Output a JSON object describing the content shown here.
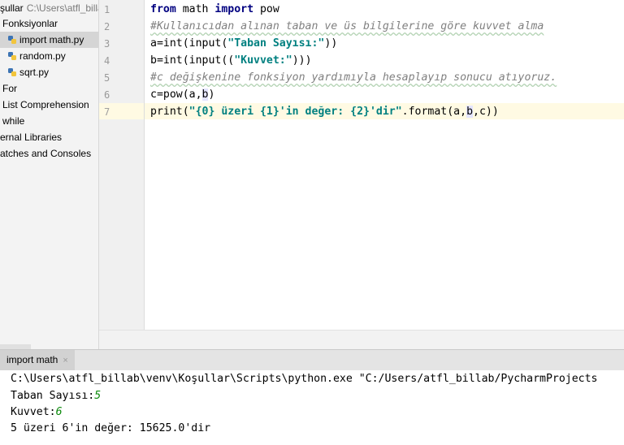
{
  "tree": {
    "root_label": "şullar",
    "root_path": "C:\\Users\\atfl_billab\\venv",
    "items": [
      {
        "label": "Fonksiyonlar",
        "icon": "folder-icon"
      },
      {
        "label": "import math.py",
        "icon": "python-file-icon"
      },
      {
        "label": "random.py",
        "icon": "python-file-icon"
      },
      {
        "label": "sqrt.py",
        "icon": "python-file-icon"
      },
      {
        "label": "For",
        "icon": "folder-icon"
      },
      {
        "label": "List Comprehension",
        "icon": "folder-icon"
      },
      {
        "label": "while",
        "icon": "folder-icon"
      },
      {
        "label": "ernal Libraries",
        "icon": "library-icon"
      },
      {
        "label": "atches and Consoles",
        "icon": "scratch-icon"
      }
    ]
  },
  "editor": {
    "line_numbers": [
      "1",
      "2",
      "3",
      "4",
      "5",
      "6",
      "7"
    ],
    "current_line": "7",
    "lines": {
      "l1": {
        "kw1": "from",
        "t1": " math ",
        "kw2": "import",
        "t2": " pow"
      },
      "l2": {
        "comment": "#Kullanıcıdan alınan taban ve üs bilgilerine göre kuvvet alma"
      },
      "l3": {
        "t1": "a=int(input(",
        "str": "\"Taban Sayısı:\"",
        "t2": "))"
      },
      "l4": {
        "t1": "b",
        "t2": "=int(input((",
        "str": "\"Kuvvet:\"",
        "t3": ")))"
      },
      "l5": {
        "comment": "#c değişkenine fonksiyon yardımıyla hesaplayıp sonucu atıyoruz."
      },
      "l6": {
        "t1": "c=pow(a,",
        "hl": "b",
        "t2": ")"
      },
      "l7": {
        "t1": "print(",
        "str": "\"{0} üzeri {1}'in değer: {2}'dir\"",
        "t2": ".format(a,",
        "hl": "b",
        "t3": ",c))"
      }
    }
  },
  "run": {
    "tab_label": "import math",
    "tab_close": "×",
    "console": {
      "cmd": "C:\\Users\\atfl_billab\\venv\\Koşullar\\Scripts\\python.exe \"C:/Users/atfl_billab/PycharmProjects",
      "prompt1": "Taban Sayısı:",
      "input1": "5",
      "prompt2": "Kuvvet:",
      "input2": "6",
      "result": "5 üzeri 6'in değer: 15625.0'dir"
    }
  },
  "colors": {
    "keyword": "#000080",
    "string": "#008080",
    "comment": "#808080",
    "console_input": "#0c8a0c"
  }
}
